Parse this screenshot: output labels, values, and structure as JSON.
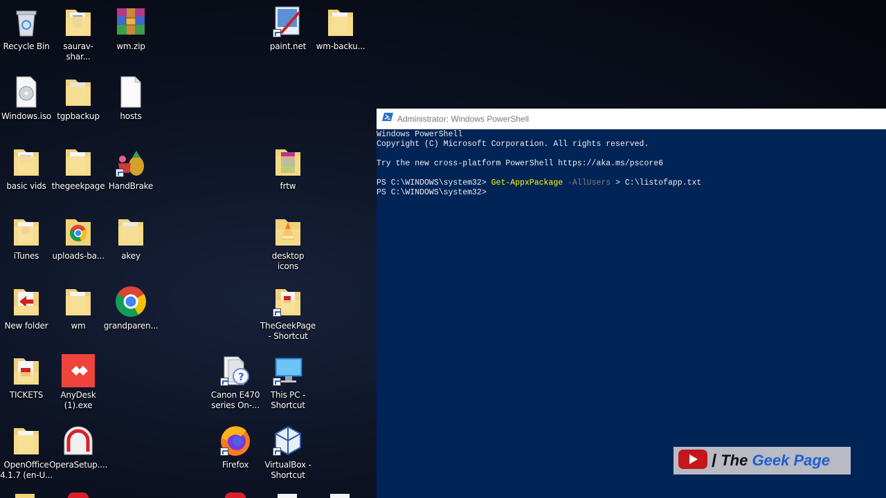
{
  "desktop": {
    "icons": [
      {
        "label": "Recycle Bin",
        "icon": "recycle-bin-icon"
      },
      {
        "label": "saurav-shar...",
        "icon": "folder-icon"
      },
      {
        "label": "wm.zip",
        "icon": "winrar-archive-icon"
      },
      {
        "label": "paint.net",
        "icon": "paint-net-icon"
      },
      {
        "label": "wm-backu...",
        "icon": "folder-icon"
      },
      {
        "label": "Windows.iso",
        "icon": "disc-image-icon"
      },
      {
        "label": "tgpbackup",
        "icon": "folder-icon"
      },
      {
        "label": "hosts",
        "icon": "file-icon"
      },
      {
        "label": "basic vids",
        "icon": "folder-icon"
      },
      {
        "label": "thegeekpage",
        "icon": "folder-icon"
      },
      {
        "label": "HandBrake",
        "icon": "handbrake-icon"
      },
      {
        "label": "frtw",
        "icon": "folder-icon"
      },
      {
        "label": "iTunes",
        "icon": "folder-icon"
      },
      {
        "label": "uploads-ba...",
        "icon": "folder-icon"
      },
      {
        "label": "akey",
        "icon": "folder-icon"
      },
      {
        "label": "desktop\nicons",
        "icon": "folder-icon"
      },
      {
        "label": "New folder",
        "icon": "folder-icon"
      },
      {
        "label": "wm",
        "icon": "folder-icon"
      },
      {
        "label": "grandparen...",
        "icon": "chrome-icon"
      },
      {
        "label": "TheGeekPage\n- Shortcut",
        "icon": "folder-shortcut-icon"
      },
      {
        "label": "TICKETS",
        "icon": "folder-icon"
      },
      {
        "label": "AnyDesk\n(1).exe",
        "icon": "anydesk-icon"
      },
      {
        "label": "Canon E470\nseries On-...",
        "icon": "canon-help-icon"
      },
      {
        "label": "This PC -\nShortcut",
        "icon": "this-pc-icon"
      },
      {
        "label": "OpenOffice\n4.1.7 (en-U...",
        "icon": "folder-icon"
      },
      {
        "label": "OperaSetup....",
        "icon": "opera-setup-icon"
      },
      {
        "label": "Firefox",
        "icon": "firefox-icon"
      },
      {
        "label": "VirtualBox -\nShortcut",
        "icon": "virtualbox-icon"
      }
    ]
  },
  "powershell": {
    "title": "Administrator: Windows PowerShell",
    "lines": {
      "header": "Windows PowerShell",
      "copyright": "Copyright (C) Microsoft Corporation. All rights reserved.",
      "tip": "Try the new cross-platform PowerShell https://aka.ms/pscore6",
      "prompt1": "PS C:\\WINDOWS\\system32> ",
      "command": "Get-AppxPackage",
      "param": " -AllUsers",
      "redirect": " > C:\\listofapp.txt",
      "prompt2": "PS C:\\WINDOWS\\system32>"
    },
    "colors": {
      "background": "#012456",
      "text": "#eeedf0",
      "command": "#ffff00",
      "param": "#808080"
    }
  },
  "watermark": {
    "the": "The",
    "geek": "Geek",
    "page": "Page",
    "icon": "youtube-icon"
  }
}
